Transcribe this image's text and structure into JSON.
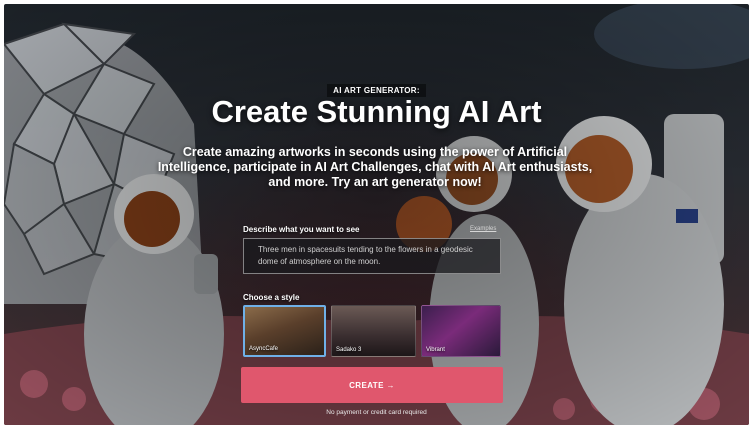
{
  "hero": {
    "eyebrow": "AI ART GENERATOR:",
    "title": "Create Stunning AI Art",
    "subtitle": "Create amazing artworks in seconds using the power of Artificial Intelligence, participate in AI Art Challenges, chat with AI Art enthusiasts, and more. Try an art generator now!"
  },
  "prompt": {
    "label": "Describe what you want to see",
    "link_label": "Examples",
    "value": "Three men in spacesuits tending to the flowers in a geodesic dome of atmosphere on the moon."
  },
  "styles": {
    "label": "Choose a style",
    "items": [
      {
        "caption": "AsyncCafe",
        "selected": true
      },
      {
        "caption": "Sadako 3",
        "selected": false
      },
      {
        "caption": "Vibrant",
        "selected": false
      }
    ]
  },
  "cta": {
    "label": "CREATE →",
    "footnote": "No payment or credit card required"
  },
  "colors": {
    "accent": "#e0576d",
    "selected_border": "#6fb0e8"
  },
  "icons": {
    "arrow": "arrow-right-icon"
  }
}
